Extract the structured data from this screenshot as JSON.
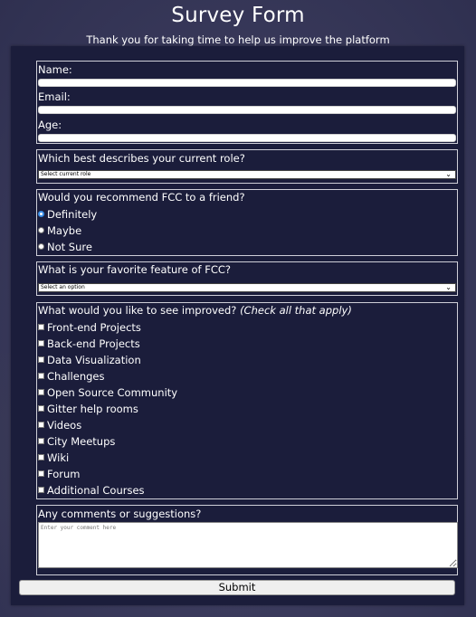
{
  "header": {
    "title": "Survey Form",
    "subtitle": "Thank you for taking time to help us improve the platform"
  },
  "personal": {
    "name_label": "Name:",
    "email_label": "Email:",
    "age_label": "Age:"
  },
  "role": {
    "label": "Which best describes your current role?",
    "selected": "Select current role"
  },
  "recommend": {
    "label": "Would you recommend FCC to a friend?",
    "options": [
      "Definitely",
      "Maybe",
      "Not Sure"
    ],
    "selected_index": 0
  },
  "feature": {
    "label": "What is your favorite feature of FCC?",
    "selected": "Select an option"
  },
  "improve": {
    "label": "What would you like to see improved?",
    "hint": "(Check all that apply)",
    "options": [
      "Front-end Projects",
      "Back-end Projects",
      "Data Visualization",
      "Challenges",
      "Open Source Community",
      "Gitter help rooms",
      "Videos",
      "City Meetups",
      "Wiki",
      "Forum",
      "Additional Courses"
    ]
  },
  "comments": {
    "label": "Any comments or suggestions?",
    "placeholder": "Enter your comment here"
  },
  "submit_label": "Submit",
  "colors": {
    "panel": "#1b1d3b",
    "background": "#3c3c5e",
    "radio_selected": "#3a8ee6"
  },
  "icons": {
    "select_arrow": "chevron-down-icon",
    "textarea_resize": "resize-handle-icon"
  }
}
